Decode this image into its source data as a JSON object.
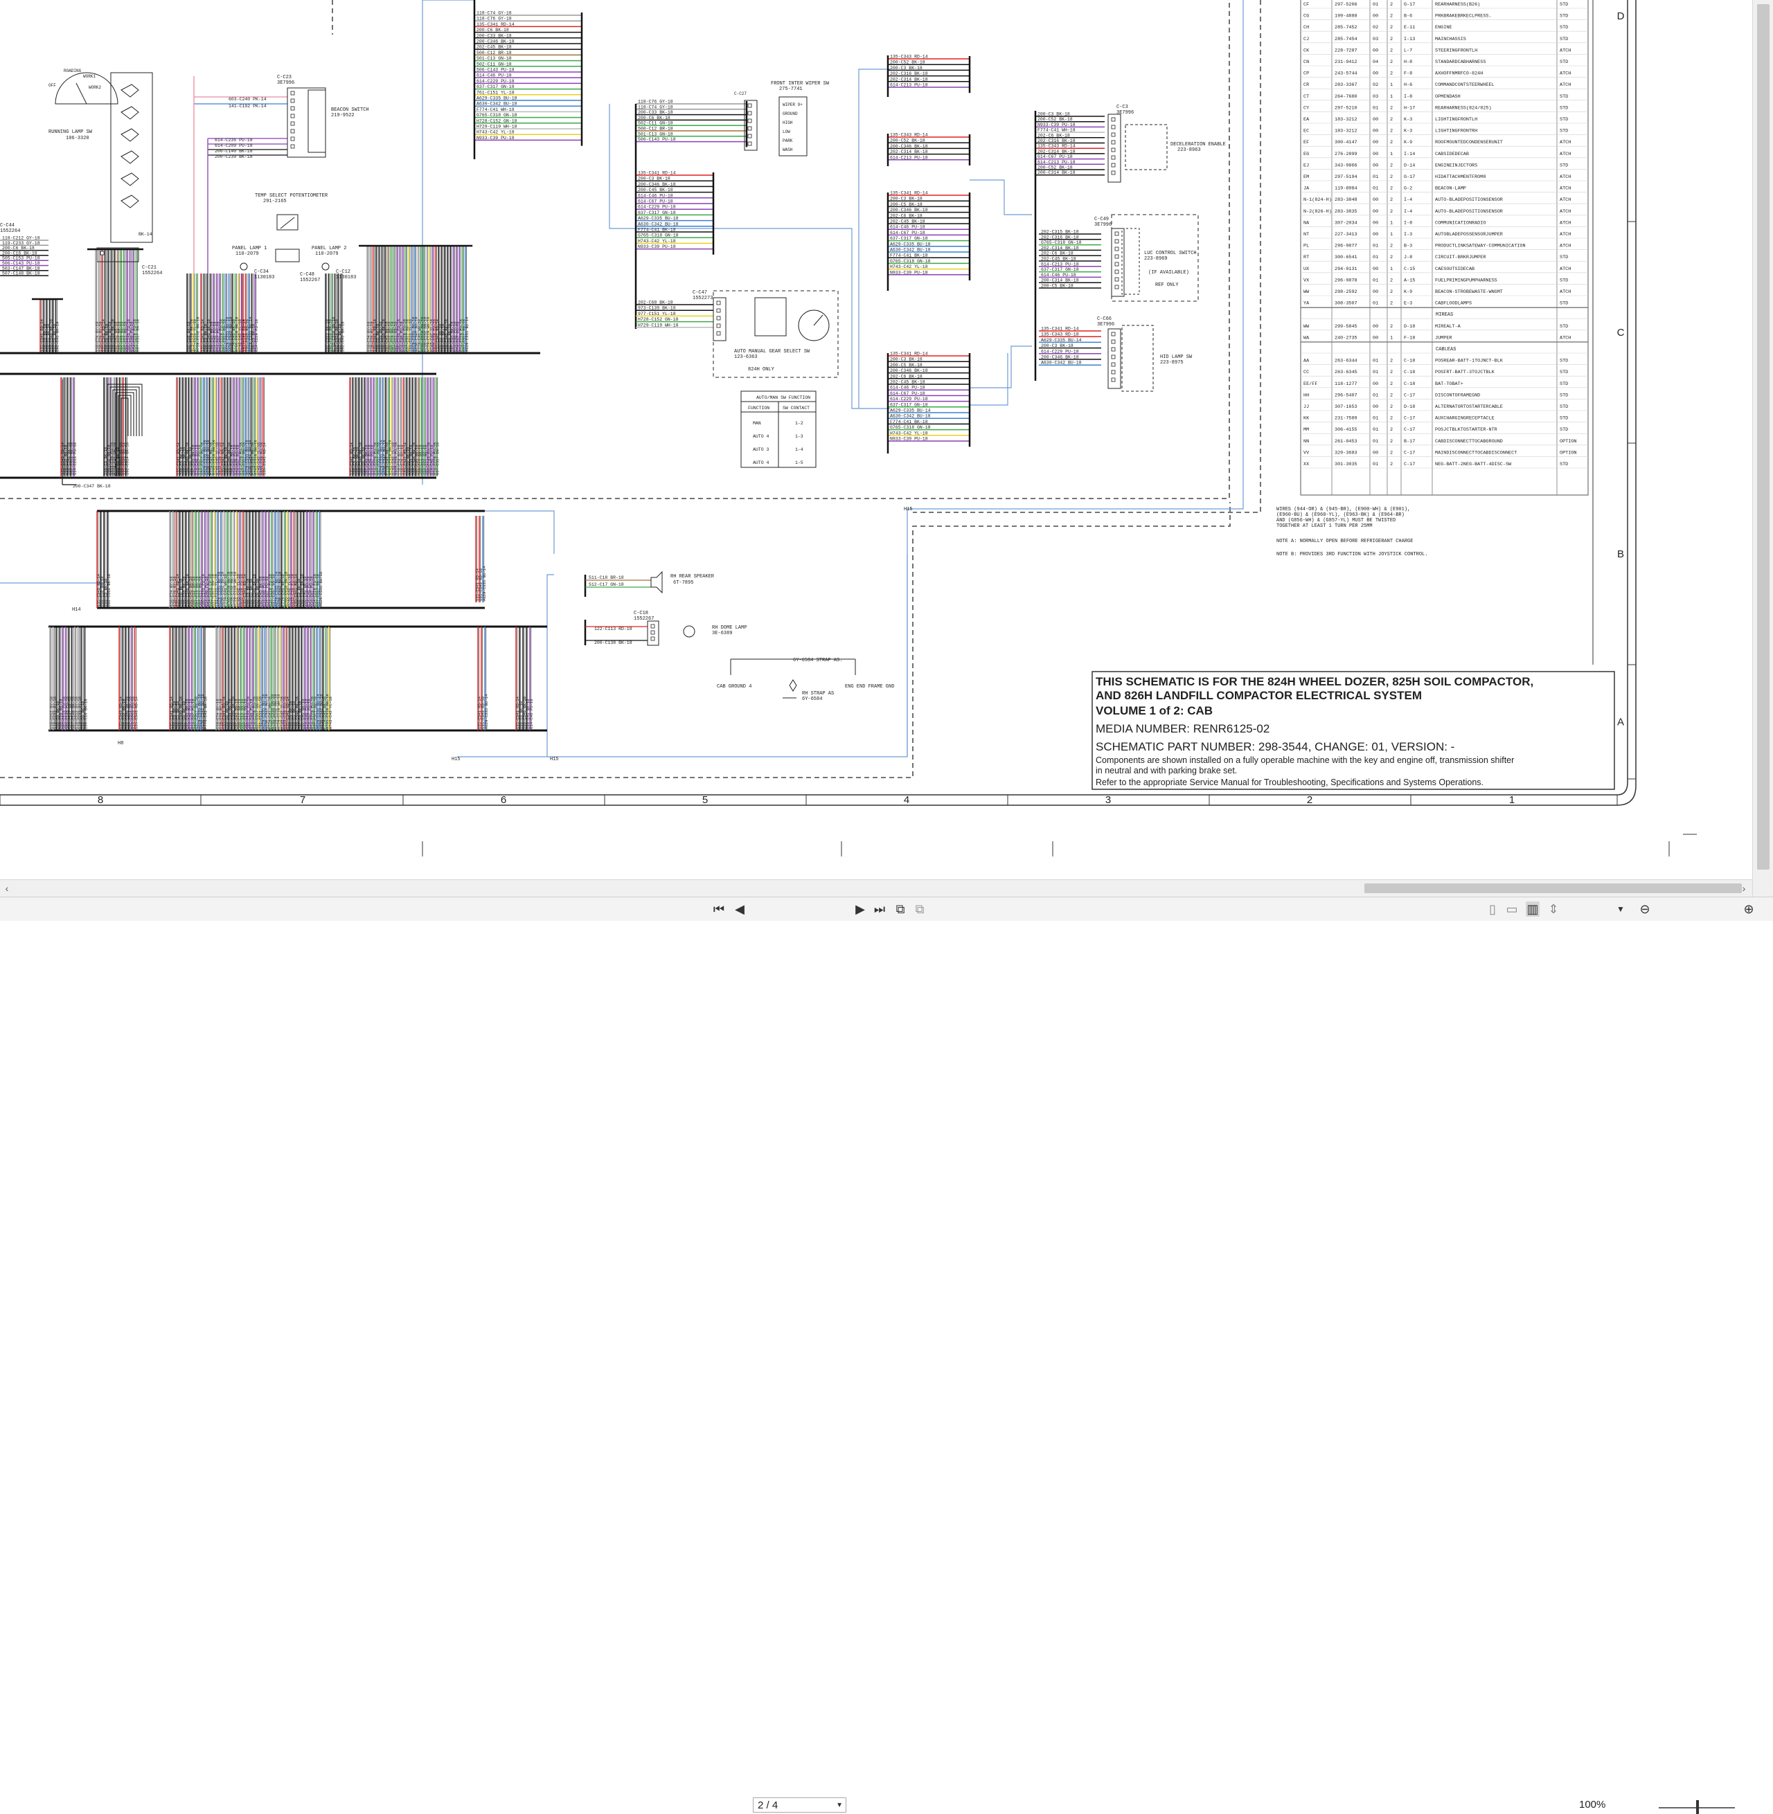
{
  "title_block": {
    "line1": "THIS SCHEMATIC IS FOR THE 824H WHEEL DOZER, 825H SOIL COMPACTOR,",
    "line2": "AND 826H LANDFILL COMPACTOR ELECTRICAL SYSTEM",
    "line3": "VOLUME 1 of 2: CAB",
    "media": "MEDIA NUMBER: RENR6125-02",
    "part": "SCHEMATIC PART NUMBER: 298-3544, CHANGE: 01, VERSION: -",
    "note1": "Components are shown installed on a fully operable machine with the key and engine off, transmission shifter",
    "note2": "in neutral and with parking brake set.",
    "note3": "Refer to the appropriate Service Manual for Troubleshooting, Specifications and Systems Operations."
  },
  "notes": {
    "wires_note_1": "WIRES (944-OR) & (945-BR), (E900-WH) & (E901),",
    "wires_note_2": "(E960-BU) & (E960-YL), (E963-BK) & (E964-BR)",
    "wires_note_3": "AND (G856-WH) & (G857-YL) MUST BE TWISTED",
    "wires_note_4": "TOGETHER AT LEAST 1 TURN PER 25MM",
    "note_a": "NOTE A:  NORMALLY OPEN BEFORE REFRIGERANT CHARGE",
    "note_b": "NOTE B:  PROVIDES 3RD FUNCTION WITH JOYSTICK CONTROL."
  },
  "column_numbers": [
    "8",
    "7",
    "6",
    "5",
    "4",
    "3",
    "2",
    "1"
  ],
  "row_letters": [
    "D",
    "C",
    "B",
    "A"
  ],
  "harness_table": {
    "rows": [
      [
        "CF",
        "297-5206",
        "01",
        "2",
        "G-17",
        "REARHARNESS(B26)",
        "STD"
      ],
      [
        "CG",
        "199-4888",
        "00",
        "2",
        "B-6",
        "PRKBRAKEBRKECLPRESS.",
        "STD"
      ],
      [
        "CH",
        "285-7452",
        "02",
        "2",
        "E-11",
        "ENGINE",
        "STD"
      ],
      [
        "CJ",
        "285-7454",
        "03",
        "2",
        "I-13",
        "MAINCHASSIS",
        "STD"
      ],
      [
        "CK",
        "228-7287",
        "00",
        "2",
        "L-7",
        "STEERINGFRONTLH",
        "ATCH"
      ],
      [
        "CN",
        "231-9412",
        "04",
        "2",
        "H-8",
        "STANDARDCABHARNESS",
        "STD"
      ],
      [
        "CP",
        "243-5744",
        "00",
        "2",
        "F-8",
        "AXHOFFNMRFC0-824H",
        "ATCH"
      ],
      [
        "CR",
        "283-3367",
        "02",
        "1",
        "H-6",
        "COMMANDCONTSTEERWHEEL",
        "ATCH"
      ],
      [
        "CT",
        "264-7680",
        "03",
        "1",
        "I-8",
        "OPMENDASH",
        "STD"
      ],
      [
        "CY",
        "297-5210",
        "01",
        "2",
        "H-17",
        "REARHARNESS(824/825)",
        "STD"
      ],
      [
        "EA",
        "183-3212",
        "00",
        "2",
        "K-3",
        "LIGHTINGFRONTLH",
        "STD"
      ],
      [
        "EC",
        "183-3212",
        "00",
        "2",
        "K-3",
        "LIGHTINGFRONTRH",
        "STD"
      ],
      [
        "EF",
        "300-4147",
        "00",
        "2",
        "K-9",
        "ROOFMOUNTEDCONDENSERUNIT",
        "ATCH"
      ],
      [
        "EG",
        "276-2899",
        "00",
        "1",
        "I-14",
        "CABSIDEDECAB",
        "ATCH"
      ],
      [
        "EJ",
        "343-9866",
        "00",
        "2",
        "D-14",
        "ENGINEINJECTORS",
        "STD"
      ],
      [
        "EM",
        "297-5194",
        "01",
        "2",
        "G-17",
        "HIDATTACHMENTFROM8",
        "ATCH"
      ],
      [
        "JA",
        "119-8984",
        "01",
        "2",
        "G-2",
        "BEACON-LAMP",
        "ATCH"
      ],
      [
        "N-1(824-H)",
        "283-3848",
        "00",
        "2",
        "I-4",
        "AUTO-BLADEPOSITIONSENSOR",
        "ATCH"
      ],
      [
        "N-2(826-H)",
        "283-3835",
        "00",
        "2",
        "I-4",
        "AUTO-BLADEPOSITIONSENSOR",
        "ATCH"
      ],
      [
        "NA",
        "307-2034",
        "00",
        "1",
        "I-8",
        "COMMUNICATIONRADIO",
        "ATCH"
      ],
      [
        "NT",
        "227-3413",
        "00",
        "1",
        "I-3",
        "AUTOBLADEPOSSENSORJUMPER",
        "ATCH"
      ],
      [
        "PL",
        "296-9877",
        "01",
        "2",
        "B-3",
        "PRODUCTLINKSATEWAY-COMMUNICATION",
        "ATCH"
      ],
      [
        "RT",
        "300-6541",
        "01",
        "2",
        "J-8",
        "CIRCUIT-BRKRJUMPER",
        "STD"
      ],
      [
        "UX",
        "294-0131",
        "00",
        "1",
        "C-15",
        "CAESOUTSIDECAB",
        "ATCH"
      ],
      [
        "VX",
        "296-9878",
        "01",
        "2",
        "A-15",
        "FUELPRIMINGPUMPHARNESS",
        "STD"
      ],
      [
        "WW",
        "298-2592",
        "00",
        "2",
        "K-9",
        "BEACON-STROBEWASTE-WNGMT",
        "ATCH"
      ],
      [
        "YA",
        "308-3507",
        "01",
        "2",
        "E-3",
        "CABFLOODLAMPS",
        "STD"
      ]
    ],
    "section_mireas": "MIREAS",
    "rows_mireas": [
      [
        "WW",
        "299-5845",
        "00",
        "2",
        "D-18",
        "MIREALT-A",
        "STD"
      ],
      [
        "WA",
        "240-2735",
        "00",
        "1",
        "F-18",
        "JUMPER",
        "ATCH"
      ]
    ],
    "section_cables": "CABLEAS",
    "rows_cables": [
      [
        "AA",
        "263-6344",
        "01",
        "2",
        "C-18",
        "POSREAR-BATT-1TOJNCT-BLK",
        "STD"
      ],
      [
        "CC",
        "263-6345",
        "01",
        "2",
        "C-18",
        "POSFRT-BATT-3TOJCTBLK",
        "STD"
      ],
      [
        "EE/FF",
        "118-1277",
        "00",
        "2",
        "C-18",
        "BAT-TOBAT+",
        "STD"
      ],
      [
        "HH",
        "296-5407",
        "01",
        "2",
        "C-17",
        "DISCONTOFRAMEGND",
        "STD"
      ],
      [
        "JJ",
        "307-1653",
        "00",
        "2",
        "D-18",
        "ALTERNATORTOSTARTERCABLE",
        "STD"
      ],
      [
        "KK",
        "231-7589",
        "01",
        "2",
        "C-17",
        "AUXCHARGINGRECEPTACLE",
        "STD"
      ],
      [
        "MM",
        "306-4155",
        "01",
        "2",
        "C-17",
        "POSJCTBLKTOSTARTER-NTR",
        "STD"
      ],
      [
        "NN",
        "261-0453",
        "01",
        "2",
        "B-17",
        "CABDISCONNECTTOCABGROUND",
        "OPTION"
      ],
      [
        "VV",
        "329-3683",
        "00",
        "2",
        "C-17",
        "MAINDISCONNECTTOCABDISCONNECT",
        "OPTION"
      ],
      [
        "XX",
        "301-3035",
        "01",
        "2",
        "C-17",
        "NEG-BATT-2NEG-BATT-4DISC-SW",
        "STD"
      ]
    ]
  },
  "components": {
    "running_lamp_sw": "RUNNING LAMP SW",
    "running_lamp_sw_pn": "106-3320",
    "running_lamp_marks": [
      "OFF",
      "ROADING",
      "WORK1",
      "WORK2"
    ],
    "beacon_switch": "BEACON SWITCH",
    "beacon_switch_pn": "219-9522",
    "c23": "C-C23",
    "c23_pn": "3E7996",
    "temp_select": "TEMP SELECT POTENTIOMETER",
    "temp_select_pn": "291-2165",
    "panel_lamp_1": "PANEL LAMP 1",
    "panel_lamp_1_pn": "110-2079",
    "panel_lamp_2": "PANEL LAMP 2",
    "panel_lamp_2_pn": "110-2079",
    "c34": "C-C34",
    "c34_pn": "1130183",
    "c48": "C-C48",
    "c48_pn": "1552267",
    "c12": "C-C12",
    "c12_pn": "1130183",
    "c21": "C-C21",
    "c21_pn": "1552264",
    "c44": "C-C44",
    "c44_pn": "1552264",
    "front_wiper_sw": "FRONT INTER WIPER SW",
    "front_wiper_sw_pn": "275-7741",
    "wiper_positions": [
      "WIPER 9+",
      "GROUND",
      "HIGH",
      "LOW",
      "PARK",
      "WASH"
    ],
    "c27": "C-C27",
    "c47": "C-C47",
    "c47_pn": "1552273",
    "auto_manual": "AUTO MANUAL GEAR SELECT SW",
    "auto_manual_pn": "123-6363",
    "auto_manual_note": "824H ONLY",
    "auto_manual_table_title": "AUTO/MAN SW FUNCTION",
    "auto_manual_table_head": [
      "FUNCTION",
      "SW CONTACT"
    ],
    "auto_manual_table_rows": [
      [
        "MAN",
        "1-2"
      ],
      [
        "AUTO 4",
        "1-3"
      ],
      [
        "AUTO 3",
        "1-4"
      ],
      [
        "AUTO 4",
        "1-5"
      ]
    ],
    "c3": "C-C3",
    "c3_pn": "3E7996",
    "decel_enable": "DECELERATION ENABLE",
    "decel_enable_pn": "223-8963",
    "c49": "C-C49",
    "c49_pn": "3E7996",
    "luc_control": "LUC CONTROL SWITCH",
    "luc_control_pn": "223-8969",
    "luc_note1": "(IF AVAILABLE)",
    "luc_note2": "REF ONLY",
    "c66": "C-C66",
    "c66_pn": "3E7996",
    "hid_lamp_sw": "HID LAMP SW",
    "hid_lamp_sw_pn": "223-8975",
    "rh_rear_speaker": "RH REAR SPEAKER",
    "rh_rear_speaker_pn": "6T-7895",
    "c18": "C-C18",
    "c18_pn": "1552267",
    "rh_dome_lamp": "RH DOME LAMP",
    "rh_dome_lamp_pn": "3E-6389",
    "cab_ground": "CAB GROUND 4",
    "eng_end_frame": "ENG END FRAME GND",
    "strap": "6Y-6584 STRAP AS.",
    "rh_strap": "RH STRAP AS",
    "rh_strap_pn": "6Y-6584",
    "marker_h15": "H15",
    "marker_h14": "H14",
    "marker_h8": "H8",
    "wire_200_c347": "200-C347 BK-18",
    "wire_511_c18": "511-C18 BR-18",
    "wire_512_c17": "512-C17 GN-18",
    "wire_122_c113": "122-C113 RD-18",
    "wire_200_c138": "200-C138 BK-18",
    "wire_603_c240": "603-C240 PK-14",
    "wire_141_c192": "141-C192 PK-14",
    "wire_614_c235": "614-C235 PU-18",
    "wire_614_c209": "614-C209 PU-18",
    "wire_200_c140": "200-C140 BK-18",
    "wire_200_c239": "200-C239 BK-18",
    "wire_bk14": "BK-14"
  },
  "wire_labels": {
    "bundle_a": [
      "118-C74 GY-18",
      "118-C76 GY-18",
      "135-C341 RD-14",
      "200-C6 BK-18",
      "200-C33 BK-18",
      "200-C346 BK-18",
      "202-C45 BK-18",
      "500-C12 BR-18",
      "501-C13 GN-18",
      "502-C11 GN-18",
      "506-C143 PU-18",
      "614-C46 PU-18",
      "614-C229 PU-18",
      "637-C317 GN-18",
      "761-C151 YL-18",
      "A629-C335 BU-18",
      "A630-C342 BU-18",
      "F774-C41 WH-18",
      "G765-C318 GN-18",
      "H728-C152 GN-18",
      "H729-C119 WH-18",
      "H743-C42 YL-18",
      "N933-C39 PU-18"
    ],
    "bundle_wiper": [
      "118-C76 GY-18",
      "118-C74 GY-18",
      "200-C33 BK-18",
      "200-C6 BK-18",
      "502-C11 GN-18",
      "500-C12 BR-18",
      "501-C13 GN-18",
      "506-C143 PU-18"
    ],
    "bundle_mid": [
      "135-C341 RD-14",
      "200-C3 BK-18",
      "200-C346 BK-18",
      "200-C45 BK-18",
      "614-C46 PU-18",
      "614-C67 PU-18",
      "614-C229 PU-18",
      "637-C317 GN-18",
      "A629-C335 BU-18",
      "A630-C342 BU-18",
      "F774-C41 BK-18",
      "G765-C318 GN-18",
      "H743-C42 YL-18",
      "N933-C39 PU-18"
    ],
    "bundle_gear": [
      "202-C68 BK-18",
      "973-C139 BK-18",
      "977-C151 YL-18",
      "H728-C152 GN-18",
      "H729-C119 WH-18"
    ],
    "bundle_r1": [
      "135-C343 RD-14",
      "200-C52 BK-18",
      "200-C3 BK-18",
      "202-C316 BK-18",
      "202-C314 BK-18",
      "614-C213 PU-18"
    ],
    "bundle_r2": [
      "135-C343 RD-14",
      "200-C52 BK-18",
      "200-C346 BK-18",
      "202-C314 BK-18",
      "614-C213 PU-18"
    ],
    "bundle_r3": [
      "135-C341 RD-14",
      "200-C3 BK-18",
      "200-C5 BK-18",
      "200-C346 BK-18",
      "202-C6 BK-18",
      "202-C45 BK-18",
      "614-C46 PU-18",
      "614-C67 PU-18",
      "637-C317 GN-18",
      "A629-C335 BU-18",
      "A630-C342 BU-18",
      "F774-C41 BK-18",
      "G765-C318 GN-18",
      "H743-C42 YL-18",
      "N933-C39 PU-18"
    ],
    "bundle_r4": [
      "135-C341 RD-14",
      "200-C3 BK-18",
      "200-C5 BK-18",
      "200-C346 BK-18",
      "202-C6 BK-18",
      "202-C45 BK-18",
      "614-C46 PU-18",
      "614-C67 PU-18",
      "614-C229 PU-18",
      "637-C317 GN-18",
      "A629-C335 BU-14",
      "A630-C342 BU-18",
      "F774-C41 BK-18",
      "G765-C318 GN-18",
      "H743-C42 YL-18",
      "N933-C39 PU-18"
    ],
    "bundle_c3": [
      "200-C3 BK-18",
      "200-C52 BK-18",
      "N933-C39 PU-18",
      "F774-C41 WH-18",
      "202-C6 BK-18",
      "202-C316 BK-18",
      "135-C343 RD-14",
      "202-C314 BK-18",
      "614-C67 PU-18",
      "614-C213 PU-18",
      "200-C52 BK-18",
      "200-C314 BK-18"
    ],
    "bundle_c49": [
      "202-C315 BK-18",
      "202-C316 BK-18",
      "G765-C318 GN-18",
      "202-C314 BK-18",
      "202-C6 BK-18",
      "202-C45 BK-18",
      "614-C213 PU-18",
      "637-C317 GN-18",
      "614-C46 PU-18",
      "200-C314 BK-18",
      "200-C5 BK-18"
    ],
    "bundle_c66": [
      "135-C341 RD-14",
      "135-C343 RD-18",
      "A629-C335 BU-14",
      "200-C3 BK-18",
      "614-C229 PU-18",
      "200-C346 BK-18",
      "A630-C342 BU-18"
    ],
    "bundle_left": [
      "118-C212 GY-18",
      "119-C233 GY-18",
      "200-C6 BK-18",
      "200-C16 BK-18",
      "505-C153 PU-18",
      "506-C143 PU-18",
      "503-C147 BK-18",
      "507-C148 BK-18"
    ]
  },
  "viewer": {
    "page_value": "2 / 4",
    "zoom": "100%",
    "icons": {
      "first": "first-page-icon",
      "prev": "prev-page-icon",
      "next": "next-page-icon",
      "last": "last-page-icon"
    }
  }
}
